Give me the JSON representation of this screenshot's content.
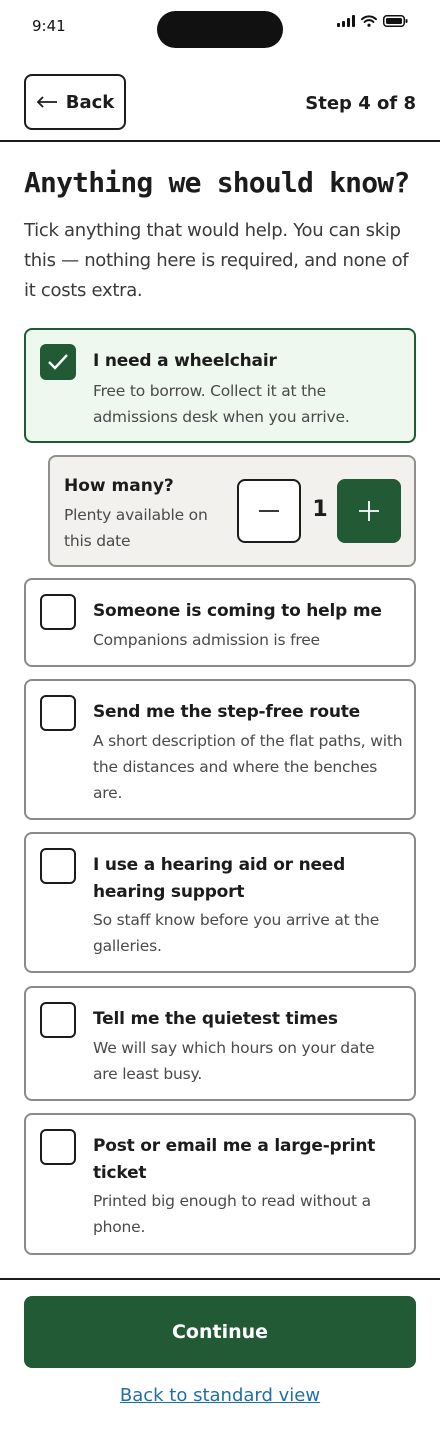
{
  "status_bar": {
    "time": "9:41"
  },
  "header": {
    "back_label": "Back",
    "step_label": "Step 4 of 8"
  },
  "main": {
    "title": "Anything we should know?",
    "intro": "Tick anything that would help. You can skip this — nothing here is required, and none of it costs extra.",
    "options": [
      {
        "title": "I need a wheelchair",
        "description": "Free to borrow. Collect it at the admissions desk when you arrive.",
        "checked": true
      },
      {
        "title": "Someone is coming to help me",
        "description": "Companions admission is free",
        "checked": false
      },
      {
        "title": "Send me the step-free route",
        "description": "A short description of the flat paths, with the distances and where the benches are.",
        "checked": false
      },
      {
        "title": "I use a hearing aid or need hearing support",
        "description": "So staff know before you arrive at the galleries.",
        "checked": false
      },
      {
        "title": "Tell me the quietest times",
        "description": "We will say which hours on your date are least busy.",
        "checked": false
      },
      {
        "title": "Post or email me a large-print ticket",
        "description": "Printed big enough to read without a phone.",
        "checked": false
      }
    ],
    "quantity": {
      "title": "How many?",
      "description": "Plenty available on this date",
      "value": "1"
    }
  },
  "footer": {
    "continue_label": "Continue",
    "standard_view_link": "Back to standard view"
  },
  "colors": {
    "accent": "#225a36",
    "selected_bg": "#eef8ee",
    "link": "#1f6fa6"
  }
}
